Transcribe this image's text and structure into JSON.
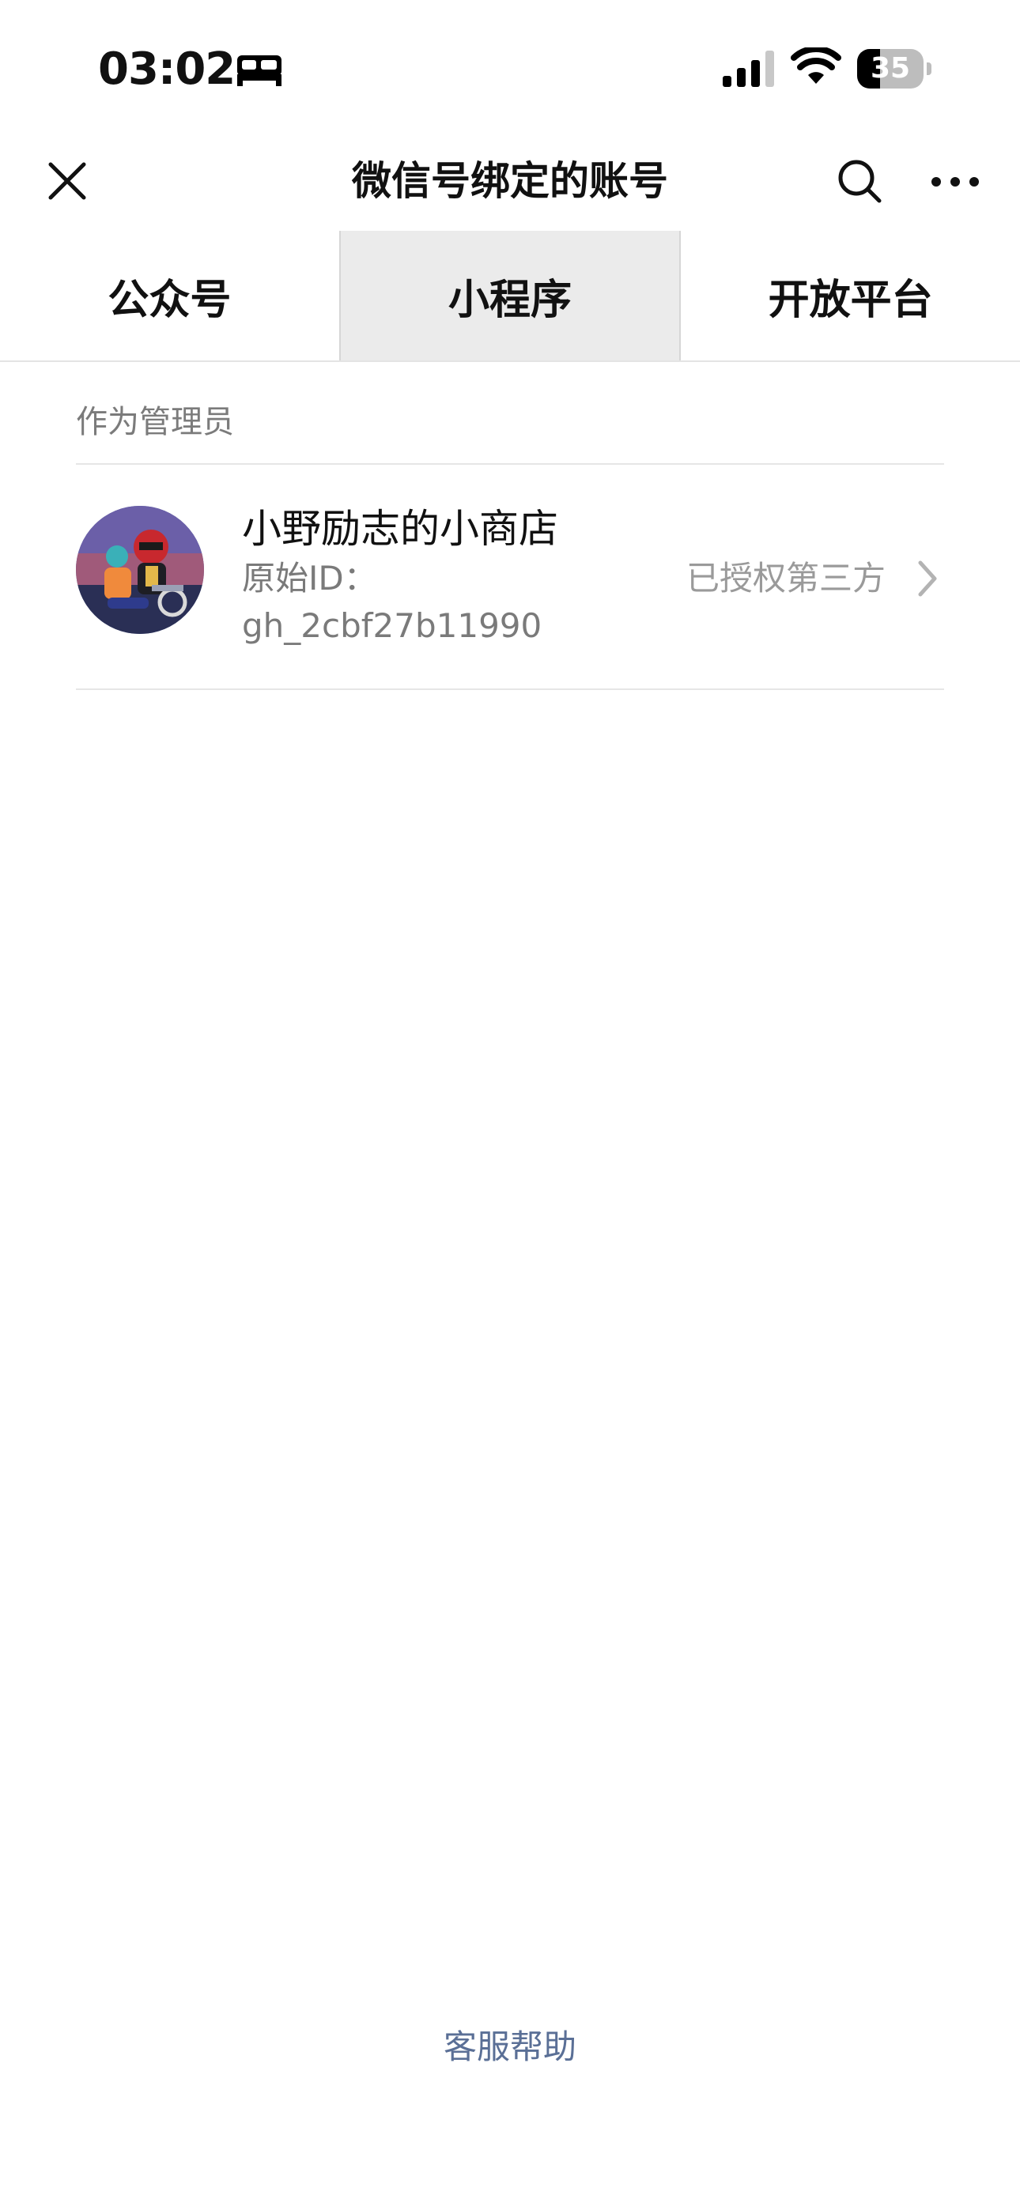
{
  "status_bar": {
    "time": "03:02",
    "battery_level": "35",
    "battery_fraction": 0.35,
    "icons": [
      "sleep-icon",
      "signal-icon",
      "wifi-icon",
      "battery-icon"
    ]
  },
  "nav": {
    "title": "微信号绑定的账号",
    "icons": [
      "close-icon",
      "search-icon",
      "more-icon"
    ]
  },
  "tabs": [
    {
      "label": "公众号",
      "active": false
    },
    {
      "label": "小程序",
      "active": true
    },
    {
      "label": "开放平台",
      "active": false
    }
  ],
  "section": {
    "header": "作为管理员",
    "items": [
      {
        "name": "小野励志的小商店",
        "id_label": "原始ID：",
        "id_value": "gh_2cbf27b11990",
        "status": "已授权第三方"
      }
    ]
  },
  "footer": {
    "help_label": "客服帮助"
  },
  "colors": {
    "active_tab_bg": "#ebebeb",
    "link": "#5a6f96",
    "secondary_text": "#7a7a7a"
  }
}
